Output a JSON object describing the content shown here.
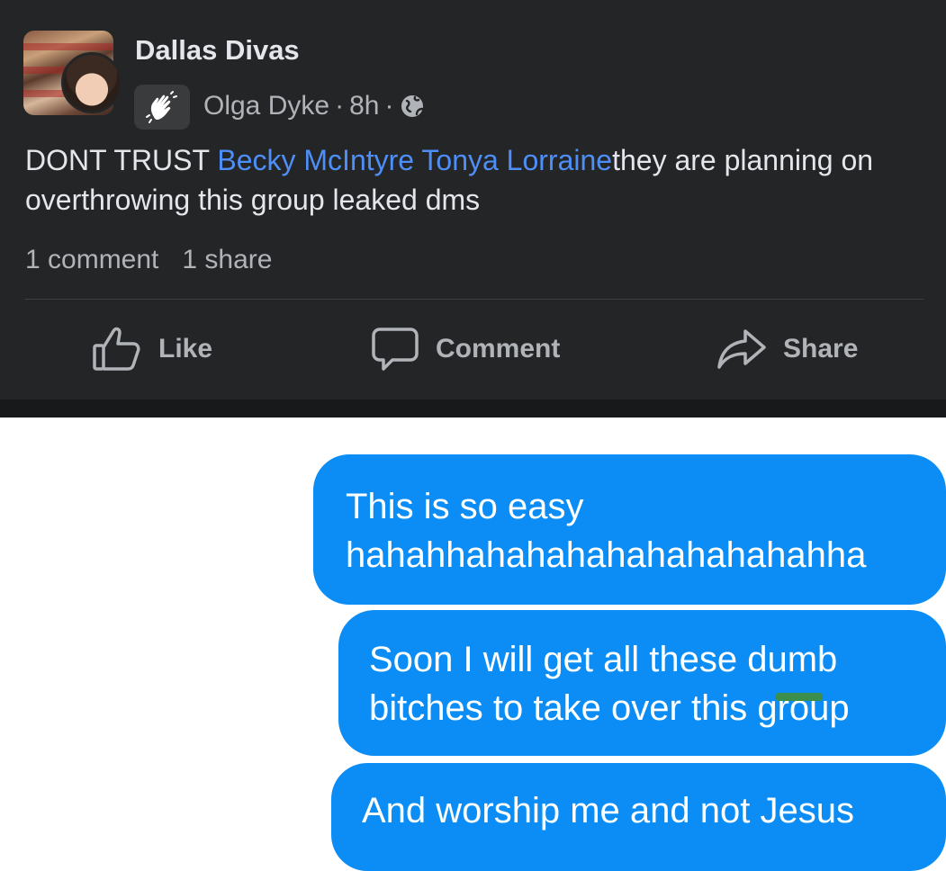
{
  "post": {
    "group_name": "Dallas Divas",
    "author": "Olga Dyke",
    "separator1": "·",
    "time": "8h",
    "separator2": "·",
    "text_prefix": "DONT TRUST ",
    "mention1": "Becky McIntyre",
    "mention_space": " ",
    "mention2": "Tonya Lorraine",
    "text_suffix": "they are planning on overthrowing this group leaked dms",
    "comments_count": "1 comment",
    "shares_count": "1 share",
    "actions": {
      "like": "Like",
      "comment": "Comment",
      "share": "Share"
    },
    "icons": {
      "badge": "waving-hand-icon",
      "privacy": "globe-icon",
      "like": "thumbs-up-icon",
      "comment": "speech-bubble-icon",
      "share": "share-arrow-icon"
    }
  },
  "messages": [
    {
      "line1": "This is so easy",
      "line2": "hahahhahahahahahahahahahha"
    },
    {
      "line1": "Soon I will get all these dumb",
      "line2": "bitches to take over this group"
    },
    {
      "line1": "And worship me and not Jesus"
    }
  ],
  "colors": {
    "post_background": "#242526",
    "mention": "#4e8ff7",
    "bubble": "#0b8df5"
  }
}
